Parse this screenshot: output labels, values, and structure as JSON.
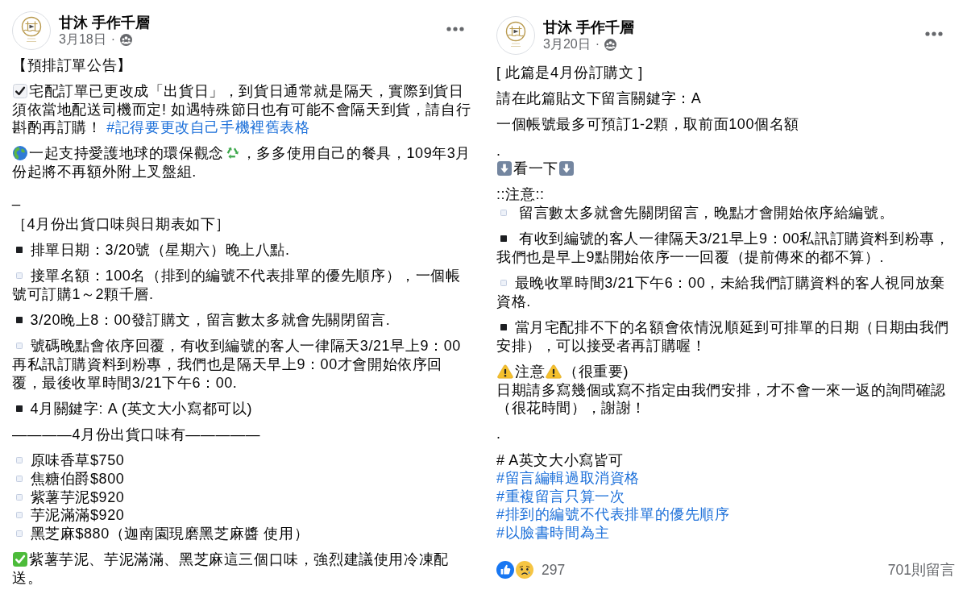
{
  "posts": [
    {
      "author": "甘沐 手作千層",
      "date": "3月18日",
      "separator": "·",
      "paragraphs": [
        {
          "lines": [
            [
              {
                "kind": "text",
                "text": "【預排訂單公告】"
              }
            ]
          ]
        },
        {
          "lines": [
            [
              {
                "kind": "tick"
              },
              {
                "kind": "text",
                "text": "宅配訂單已更改成「出貨日」，到貨日通常就是隔天，實際到貨日須依當地配送司機而定! 如遇特殊節日也有可能不會隔天到貨，請自行斟酌再訂購！ "
              },
              {
                "kind": "link",
                "text": "#記得要更改自己手機裡舊表格"
              }
            ]
          ]
        },
        {
          "lines": [
            [
              {
                "kind": "globe"
              },
              {
                "kind": "text",
                "text": "一起支持愛護地球的環保觀念"
              },
              {
                "kind": "recycle"
              },
              {
                "kind": "text",
                "text": "，多多使用自己的餐具，109年3月份起將不再額外附上叉盤組."
              }
            ]
          ]
        },
        {
          "lines": [
            [
              {
                "kind": "text",
                "text": "_"
              }
            ]
          ]
        },
        {
          "lines": [
            [
              {
                "kind": "text",
                "text": "［4月份出貨口味與日期表如下］"
              }
            ]
          ]
        },
        {
          "lines": [
            [
              {
                "kind": "square_filled"
              },
              {
                "kind": "text",
                "text": " 排單日期：3/20號（星期六）晚上八點."
              }
            ]
          ]
        },
        {
          "lines": [
            [
              {
                "kind": "square_open"
              },
              {
                "kind": "text",
                "text": " 接單名額：100名（排到的編號不代表排單的優先順序），一個帳號可訂購1～2顆千層."
              }
            ]
          ]
        },
        {
          "lines": [
            [
              {
                "kind": "square_filled"
              },
              {
                "kind": "text",
                "text": " 3/20晚上8：00發訂購文，留言數太多就會先關閉留言."
              }
            ]
          ]
        },
        {
          "lines": [
            [
              {
                "kind": "square_open"
              },
              {
                "kind": "text",
                "text": " 號碼晚點會依序回覆，有收到編號的客人一律隔天3/21早上9：00再私訊訂購資料到粉專，我們也是隔天早上9：00才會開始依序回覆，最後收單時間3/21下午6：00."
              }
            ]
          ]
        },
        {
          "lines": [
            [
              {
                "kind": "square_filled"
              },
              {
                "kind": "text",
                "text": " 4月關鍵字: A (英文大小寫都可以)"
              }
            ]
          ]
        },
        {
          "lines": [
            [
              {
                "kind": "text",
                "text": "————4月份出貨口味有—————"
              }
            ]
          ]
        },
        {
          "lines": [
            [
              {
                "kind": "square_open"
              },
              {
                "kind": "text",
                "text": " 原味香草$750"
              }
            ],
            [
              {
                "kind": "square_open"
              },
              {
                "kind": "text",
                "text": " 焦糖伯爵$800"
              }
            ],
            [
              {
                "kind": "square_open"
              },
              {
                "kind": "text",
                "text": " 紫薯芋泥$920"
              }
            ],
            [
              {
                "kind": "square_open"
              },
              {
                "kind": "text",
                "text": " 芋泥滿滿$920"
              }
            ],
            [
              {
                "kind": "square_open"
              },
              {
                "kind": "text",
                "text": " 黑芝麻$880（迦南園現磨黑芝麻醬 使用）"
              }
            ]
          ]
        },
        {
          "lines": [
            [
              {
                "kind": "check_box"
              },
              {
                "kind": "text",
                "text": "紫薯芋泥、芋泥滿滿、黑芝麻這三個口味，強烈建議使用冷凍配送。"
              }
            ]
          ]
        }
      ]
    },
    {
      "author": "甘沐 手作千層",
      "date": "3月20日",
      "separator": "·",
      "paragraphs": [
        {
          "lines": [
            [
              {
                "kind": "text",
                "text": "[ 此篇是4月份訂購文 ]"
              }
            ]
          ]
        },
        {
          "lines": [
            [
              {
                "kind": "text",
                "text": "請在此篇貼文下留言關鍵字：A"
              }
            ]
          ]
        },
        {
          "lines": [
            [
              {
                "kind": "text",
                "text": "一個帳號最多可預訂1-2顆，取前面100個名額"
              }
            ]
          ]
        },
        {
          "lines": [
            [
              {
                "kind": "text",
                "text": "."
              }
            ],
            [
              {
                "kind": "arrow_down"
              },
              {
                "kind": "text",
                "text": "看一下"
              },
              {
                "kind": "arrow_down"
              }
            ]
          ]
        },
        {
          "lines": [
            [
              {
                "kind": "text",
                "text": "::注意::"
              }
            ],
            [
              {
                "kind": "square_open"
              },
              {
                "kind": "text",
                "text": "  留言數太多就會先關閉留言，晚點才會開始依序給編號。"
              }
            ]
          ]
        },
        {
          "lines": [
            [
              {
                "kind": "square_filled"
              },
              {
                "kind": "text",
                "text": "  有收到編號的客人一律隔天3/21早上9：00私訊訂購資料到粉專，我們也是早上9點開始依序一一回覆（提前傳來的都不算）."
              }
            ]
          ]
        },
        {
          "lines": [
            [
              {
                "kind": "square_open"
              },
              {
                "kind": "text",
                "text": " 最晚收單時間3/21下午6：00，未給我們訂購資料的客人視同放棄資格."
              }
            ]
          ]
        },
        {
          "lines": [
            [
              {
                "kind": "square_filled"
              },
              {
                "kind": "text",
                "text": " 當月宅配排不下的名額會依情況順延到可排單的日期（日期由我們安排），可以接受者再訂購喔！"
              }
            ]
          ]
        },
        {
          "lines": [
            [
              {
                "kind": "warning"
              },
              {
                "kind": "text",
                "text": "注意"
              },
              {
                "kind": "warning"
              },
              {
                "kind": "text",
                "text": "（很重要)"
              }
            ],
            [
              {
                "kind": "text",
                "text": "日期請多寫幾個或寫不指定由我們安排，才不會一來一返的詢問確認（很花時間），謝謝！"
              }
            ]
          ]
        },
        {
          "lines": [
            [
              {
                "kind": "text",
                "text": "."
              }
            ]
          ]
        },
        {
          "lines": [
            [
              {
                "kind": "text",
                "text": "# A英文大小寫皆可"
              }
            ],
            [
              {
                "kind": "link",
                "text": "#留言編輯過取消資格"
              }
            ],
            [
              {
                "kind": "link",
                "text": "#重複留言只算一次"
              }
            ],
            [
              {
                "kind": "link",
                "text": "#排到的編號不代表排單的優先順序"
              }
            ],
            [
              {
                "kind": "link",
                "text": "#以臉書時間為主"
              }
            ]
          ]
        }
      ],
      "footer": {
        "reaction_count": "297",
        "comments": "701則留言"
      }
    }
  ]
}
